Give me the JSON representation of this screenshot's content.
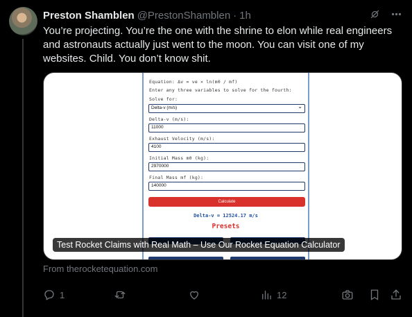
{
  "tweet": {
    "author_name": "Preston Shamblen",
    "handle": "@PrestonShamblen",
    "separator": "·",
    "time": "1h",
    "text": "You’re projecting. You’re the one with the shrine to elon while real engineers and astronauts actually just went to the moon. You can visit one of my websites. Child. You don’t know shit."
  },
  "card": {
    "calculator": {
      "equation": "Equation: Δv = ve × ln(m0 / mf)",
      "instruction": "Enter any three variables to solve for the fourth:",
      "solve_for_label": "Solve for:",
      "solve_for_value": "Delta-v (m/s)",
      "fields": [
        {
          "label": "Delta-v (m/s):",
          "value": "11000"
        },
        {
          "label": "Exhaust Velocity (m/s):",
          "value": "4100"
        },
        {
          "label": "Initial Mass m0 (kg):",
          "value": "2970000"
        },
        {
          "label": "Final Mass mf (kg):",
          "value": "140000"
        }
      ],
      "calculate_label": "Calculate",
      "result": "Delta-v = 12524.17 m/s",
      "presets_heading": "Presets"
    },
    "caption": "Test Rocket Claims with Real Math – Use Our Rocket Equation Calculator",
    "source": "From therocketequation.com"
  },
  "actions": {
    "replies": "1",
    "reposts": "",
    "likes": "",
    "views": "12"
  },
  "icons": {
    "grok": "grok-icon",
    "more": "more-icon",
    "reply": "reply-icon",
    "repost": "repost-icon",
    "like": "heart-icon",
    "views": "views-icon",
    "screenshot": "camera-icon",
    "bookmark": "bookmark-icon",
    "share": "share-icon"
  }
}
